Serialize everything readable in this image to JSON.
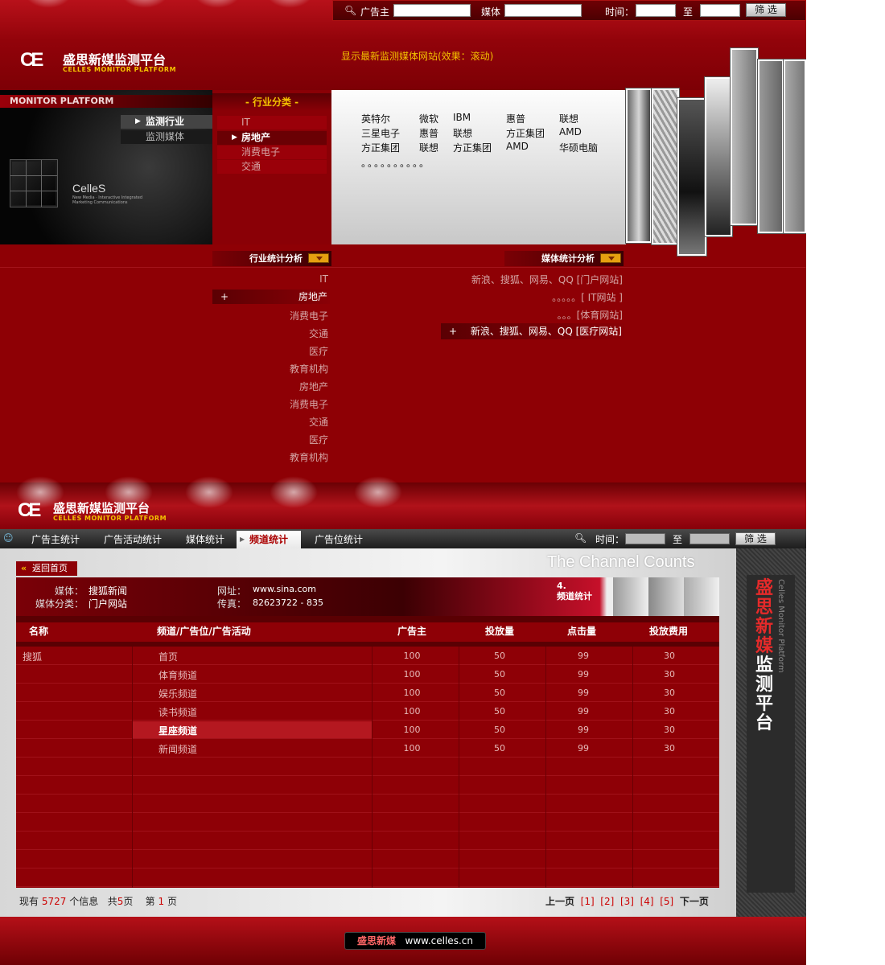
{
  "header": {
    "logo_mark": "CE",
    "logo_title": "盛思新媒监测平台",
    "logo_sub": "CELLES MONITOR PLATFORM",
    "notice": "显示最新监测媒体网站(效果：滚动)"
  },
  "search": {
    "advertiser_label": "广告主",
    "media_label": "媒体",
    "time_label": "时间：",
    "to_label": "至",
    "filter_btn": "筛 选"
  },
  "left_panel": {
    "label": "MONITOR PLATFORM",
    "items": [
      "监测行业",
      "监测媒体"
    ],
    "brand": "CelleS",
    "brand_sub": "New Media · Interactive Integrated Marketing Communications"
  },
  "category": {
    "title": "- 行业分类 -",
    "items": [
      "IT",
      "房地产",
      "消费电子",
      "交通"
    ]
  },
  "brands": {
    "rows": [
      [
        "英特尔",
        "微软",
        "IBM",
        "惠普",
        "联想"
      ],
      [
        "三星电子",
        "惠普",
        "联想",
        "方正集团",
        "AMD"
      ],
      [
        "方正集团",
        "联想",
        "方正集团",
        "AMD",
        "华硕电脑"
      ]
    ],
    "dots": "。。。。。。。。。。"
  },
  "analysis": {
    "industry_title": "行业统计分析",
    "media_title": "媒体统计分析",
    "industry_items": [
      "IT",
      "房地产",
      "消费电子",
      "交通",
      "医疗",
      "教育机构",
      "房地产",
      "消费电子",
      "交通",
      "医疗",
      "教育机构"
    ],
    "media_items": [
      "新浪、搜狐、网易、QQ [门户网站]",
      "。。。。。[ IT网站 ]",
      "。。。[体育网站]",
      "新浪、搜狐、网易、QQ [医疗网站]"
    ]
  },
  "nav": {
    "items": [
      "广告主统计",
      "广告活动统计",
      "媒体统计",
      "频道统计",
      "广告位统计"
    ],
    "time_label": "时间：",
    "to_label": "至",
    "filter_btn": "筛 选"
  },
  "content": {
    "back": "返回首页",
    "title": "The Channel Counts",
    "media_label": "媒体：",
    "media_val": "搜狐新闻",
    "cat_label": "媒体分类：",
    "cat_val": "门户网站",
    "url_label": "网址：",
    "url_val": "www.sina.com",
    "fax_label": "传真：",
    "fax_val": "82623722 - 835",
    "step_no": "4.",
    "step_name": "频道统计"
  },
  "table": {
    "headers": [
      "名称",
      "频道/广告位/广告活动",
      "广告主",
      "投放量",
      "点击量",
      "投放费用"
    ],
    "name": "搜狐",
    "rows": [
      [
        "首页",
        "100",
        "50",
        "99",
        "30"
      ],
      [
        "体育频道",
        "100",
        "50",
        "99",
        "30"
      ],
      [
        "娱乐频道",
        "100",
        "50",
        "99",
        "30"
      ],
      [
        "读书频道",
        "100",
        "50",
        "99",
        "30"
      ],
      [
        "星座频道",
        "100",
        "50",
        "99",
        "30"
      ],
      [
        "新闻频道",
        "100",
        "50",
        "99",
        "30"
      ]
    ]
  },
  "pagination": {
    "prefix": "现有",
    "count": "5727",
    "unit": "个信息",
    "total_prefix": "共",
    "total": "5",
    "total_suffix": "页",
    "page_prefix": "第",
    "page": "1",
    "page_suffix": "页",
    "prev": "上一页",
    "pages": [
      "[1]",
      "[2]",
      "[3]",
      "[4]",
      "[5]"
    ],
    "next": "下一页"
  },
  "sidebar": {
    "title_red": "盛思新媒",
    "title_white": "监测平台",
    "sub": "Celles Monitor Platform"
  },
  "footer": {
    "brand": "盛思新媒",
    "url": "www.celles.cn"
  }
}
